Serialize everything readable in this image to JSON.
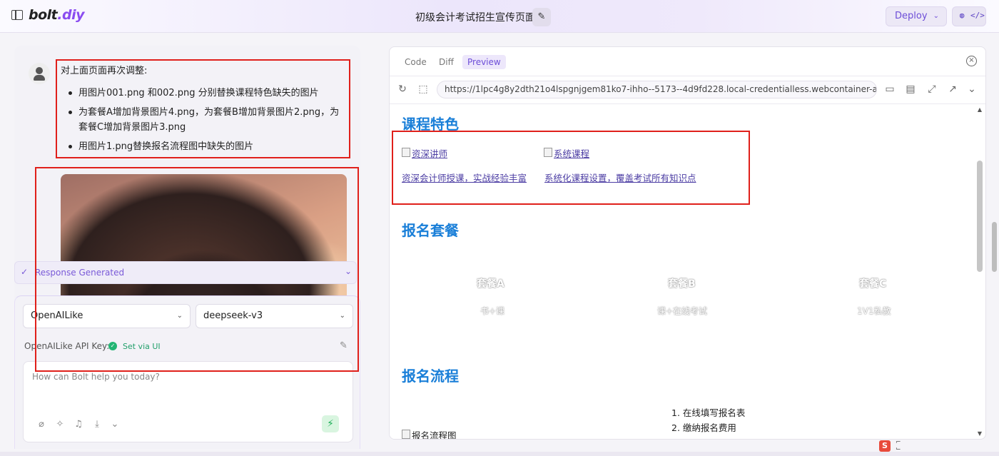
{
  "header": {
    "logo_main": "bolt",
    "logo_accent": ".diy",
    "project_title": "初级会计考试招生宣传页面",
    "deploy_label": "Deploy"
  },
  "chat": {
    "message_intro": "对上面页面再次调整:",
    "message_items": [
      "用图片001.png 和002.png 分别替换课程特色缺失的图片",
      "为套餐A增加背景图片4.png，为套餐B增加背景图片2.png，为套餐C增加背景图片3.png",
      "用图片1.png替换报名流程图中缺失的图片"
    ],
    "status": "Response Generated",
    "provider": "OpenAILike",
    "model": "deepseek-v3",
    "api_key_label": "OpenAILike API Key:",
    "api_key_status": "Set via UI",
    "input_placeholder": "How can Bolt help you today?"
  },
  "preview": {
    "tabs": [
      "Code",
      "Diff",
      "Preview"
    ],
    "active_tab": "Preview",
    "url": "https://1lpc4g8y2dth21o4lspgnjgem81ko7-ihho--5173--4d9fd228.local-credentialless.webcontainer-api.io",
    "page": {
      "features_title": "课程特色",
      "features": [
        {
          "alt": "资深讲师",
          "text": "资深会计师授课，实战经验丰富"
        },
        {
          "alt": "系统课程",
          "text": "系统化课程设置，覆盖考试所有知识点"
        }
      ],
      "packages_title": "报名套餐",
      "packages": [
        {
          "name": "套餐A",
          "desc": "书+课"
        },
        {
          "name": "套餐B",
          "desc": "课+在线考试"
        },
        {
          "name": "套餐C",
          "desc": "1V1私教"
        }
      ],
      "process_title": "报名流程",
      "process_img_alt": "报名流程图",
      "steps": [
        "1. 在线填写报名表",
        "2. 缴纳报名费用"
      ]
    }
  },
  "system": {
    "ime_label": "S"
  },
  "colors": {
    "accent": "#6d4ed8",
    "section_title": "#1a7fd8",
    "annotation": "#e0201b",
    "success": "#22b573"
  }
}
